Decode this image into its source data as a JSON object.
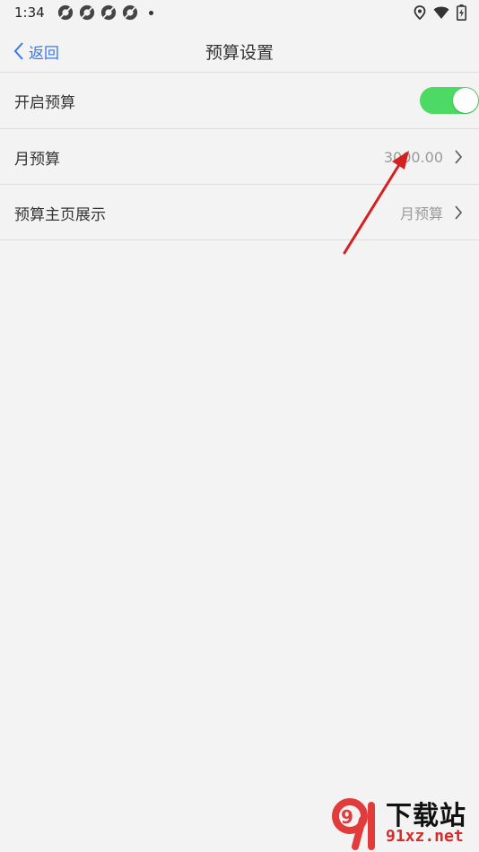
{
  "status_bar": {
    "time": "1:34",
    "icons": [
      "app-icon",
      "app-icon",
      "app-icon",
      "app-icon",
      "notification-dot-icon"
    ],
    "right_icons": [
      "location-icon",
      "wifi-icon",
      "battery-charging-icon"
    ]
  },
  "nav": {
    "back_label": "返回",
    "title": "预算设置"
  },
  "settings": [
    {
      "label": "开启预算",
      "type": "toggle",
      "enabled": true
    },
    {
      "label": "月预算",
      "value": "3000.00",
      "type": "link"
    },
    {
      "label": "预算主页展示",
      "value": "月预算",
      "type": "link"
    }
  ],
  "colors": {
    "accent": "#3a78e7",
    "toggle_on": "#4cd964",
    "background": "#f3f3f3",
    "value_text": "#9a9a9a",
    "annotation": "#d42020"
  },
  "watermark": {
    "logo": "9",
    "brand": "下载站",
    "url": "91xz.net"
  }
}
